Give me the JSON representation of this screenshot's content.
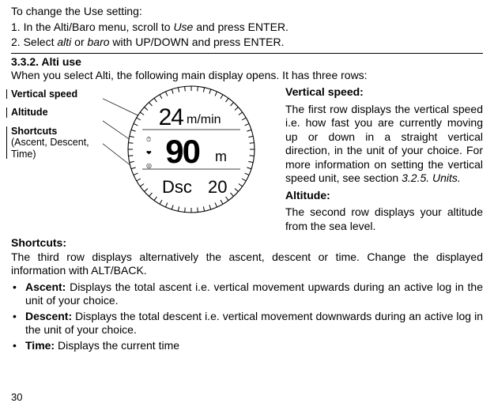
{
  "intro": {
    "line1": "To change the Use setting:",
    "step1_a": "1. In the Alti/Baro menu, scroll to ",
    "step1_use": "Use",
    "step1_b": " and press ENTER.",
    "step2_a": "2. Select ",
    "step2_alti": "alti",
    "step2_or": " or ",
    "step2_baro": "baro",
    "step2_b": " with UP/DOWN and press ENTER."
  },
  "section": {
    "number": "3.3.2.  Alti use",
    "subtitle": "When you select Alti, the following main display opens. It has three rows:"
  },
  "labels": {
    "vspeed": "Vertical speed",
    "altitude": "Altitude",
    "shortcuts": "Shortcuts",
    "shortcuts_sub": "(Ascent, Descent, Time)"
  },
  "watch": {
    "row1_value": "24",
    "row1_unit": "m/min",
    "row2_value": "90",
    "row2_unit": "m",
    "row3_label": "Dsc",
    "row3_value": "20"
  },
  "right_desc": {
    "vspeed_hdr": "Vertical speed:",
    "vspeed_body_a": "The first row displays the vertical speed i.e. how fast you are currently moving up or down in a straight vertical direction, in the unit of your choice. For more information on setting the vertical speed unit, see section ",
    "vspeed_body_ref": "3.2.5. Units.",
    "altitude_hdr": "Altitude:",
    "altitude_body": "The second row displays your altitude from the sea level."
  },
  "below": {
    "shortcuts_hdr": "Shortcuts:",
    "shortcuts_body": "The third row displays alternatively the ascent, descent or time. Change the displayed information with ALT/BACK.",
    "bullets": [
      {
        "term": "Ascent:",
        "body": " Displays the total ascent i.e. vertical movement upwards during an active log in the unit of your choice."
      },
      {
        "term": "Descent:",
        "body": " Displays the total descent i.e. vertical movement downwards during an active log in the unit of your choice."
      },
      {
        "term": "Time:",
        "body": " Displays the current time"
      }
    ]
  },
  "page_number": "30"
}
